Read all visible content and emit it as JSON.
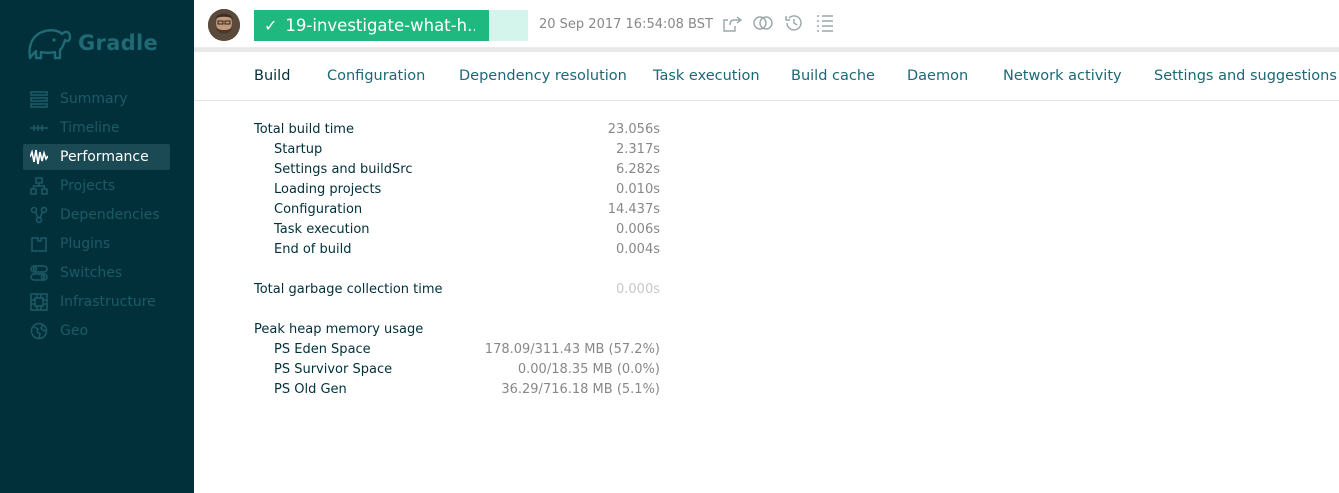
{
  "app": {
    "logo_text": "Gradle",
    "accent_color": "#1fb980",
    "sidebar_bg": "#02303a"
  },
  "sidebar": {
    "items": [
      {
        "label": "Summary",
        "icon": "summary-icon",
        "active": false
      },
      {
        "label": "Timeline",
        "icon": "timeline-icon",
        "active": false
      },
      {
        "label": "Performance",
        "icon": "performance-icon",
        "active": true
      },
      {
        "label": "Projects",
        "icon": "projects-icon",
        "active": false
      },
      {
        "label": "Dependencies",
        "icon": "dependencies-icon",
        "active": false
      },
      {
        "label": "Plugins",
        "icon": "plugins-icon",
        "active": false
      },
      {
        "label": "Switches",
        "icon": "switches-icon",
        "active": false
      },
      {
        "label": "Infrastructure",
        "icon": "infrastructure-icon",
        "active": false
      },
      {
        "label": "Geo",
        "icon": "globe-icon",
        "active": false
      }
    ]
  },
  "header": {
    "branch": "19-investigate-what-h...",
    "timestamp": "20 Sep 2017 16:54:08 BST",
    "tools": [
      "share-icon",
      "compare-icon",
      "history-icon",
      "list-icon"
    ]
  },
  "tabs": [
    {
      "label": "Build",
      "active": true
    },
    {
      "label": "Configuration",
      "active": false
    },
    {
      "label": "Dependency resolution",
      "active": false
    },
    {
      "label": "Task execution",
      "active": false
    },
    {
      "label": "Build cache",
      "active": false
    },
    {
      "label": "Daemon",
      "active": false
    },
    {
      "label": "Network activity",
      "active": false
    },
    {
      "label": "Settings and suggestions",
      "active": false
    }
  ],
  "build": {
    "total_build_time": {
      "label": "Total build time",
      "value": "23.056s"
    },
    "breakdown": [
      {
        "label": "Startup",
        "value": "2.317s"
      },
      {
        "label": "Settings and buildSrc",
        "value": "6.282s"
      },
      {
        "label": "Loading projects",
        "value": "0.010s"
      },
      {
        "label": "Configuration",
        "value": "14.437s"
      },
      {
        "label": "Task execution",
        "value": "0.006s"
      },
      {
        "label": "End of build",
        "value": "0.004s"
      }
    ],
    "gc_time": {
      "label": "Total garbage collection time",
      "value": "0.000s"
    },
    "heap": {
      "label": "Peak heap memory usage"
    },
    "heap_items": [
      {
        "label": "PS Eden Space",
        "value": "178.09/311.43 MB (57.2%)"
      },
      {
        "label": "PS Survivor Space",
        "value": "0.00/18.35 MB (0.0%)"
      },
      {
        "label": "PS Old Gen",
        "value": "36.29/716.18 MB (5.1%)"
      }
    ]
  }
}
